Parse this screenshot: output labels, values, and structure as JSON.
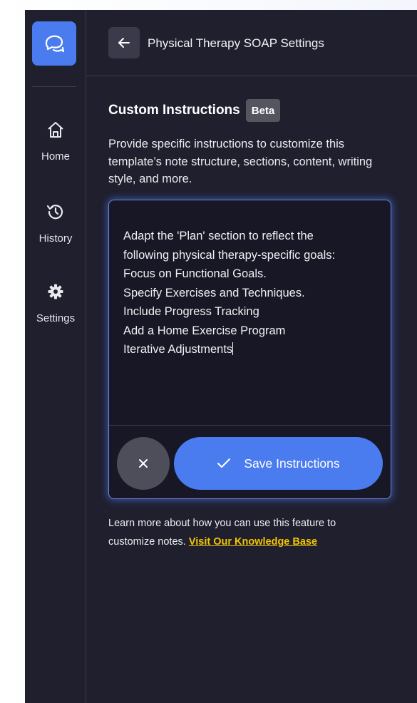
{
  "sidebar": {
    "logo_icon": "chat-bubbles-icon",
    "items": [
      {
        "label": "Home",
        "icon": "home-icon"
      },
      {
        "label": "History",
        "icon": "history-icon"
      },
      {
        "label": "Settings",
        "icon": "gear-icon"
      }
    ]
  },
  "header": {
    "back_icon": "arrow-left-icon",
    "title": "Physical Therapy SOAP Settings"
  },
  "custom_instructions": {
    "title": "Custom Instructions",
    "badge": "Beta",
    "description": "Provide specific instructions to customize this template’s note structure, sections, content, writing style, and more.",
    "textarea_lines": [
      "Adapt the 'Plan' section to reflect the",
      "following physical therapy-specific goals:",
      "Focus on Functional Goals.",
      "Specify Exercises and Techniques.",
      "Include Progress Tracking",
      "Add a Home Exercise Program",
      "Iterative Adjustments"
    ],
    "cancel_icon": "close-icon",
    "save_label": "Save Instructions",
    "save_icon": "check-icon"
  },
  "help": {
    "text": "Learn more about how you can use this feature to customize notes.",
    "link_label": "Visit Our Knowledge Base"
  },
  "colors": {
    "accent": "#4a7cf0",
    "background": "#1f1f2e",
    "link": "#f2c400"
  }
}
